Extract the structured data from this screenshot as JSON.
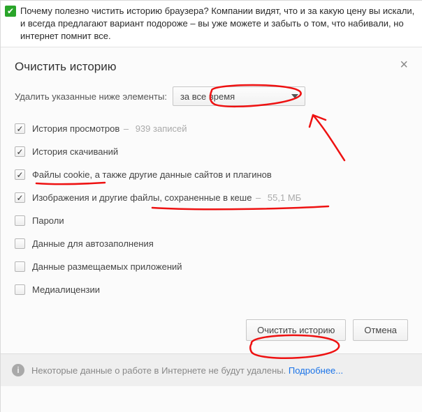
{
  "note": {
    "text": "Почему полезно чистить историю браузера? Компании видят, что и за какую цену вы искали, и всегда предлагают вариант подороже – вы уже можете и забыть о том, что набивали, но интернет помнит все."
  },
  "dialog": {
    "title": "Очистить историю",
    "close": "×",
    "deleteLabel": "Удалить указанные ниже элементы:",
    "combo": {
      "selected": "за все время"
    }
  },
  "options": [
    {
      "label": "История просмотров",
      "hint": "939 записей",
      "checked": true
    },
    {
      "label": "История скачиваний",
      "hint": "",
      "checked": true
    },
    {
      "label": "Файлы cookie, а также другие данные сайтов и плагинов",
      "hint": "",
      "checked": true
    },
    {
      "label": "Изображения и другие файлы, сохраненные в кеше",
      "hint": "55,1 МБ",
      "checked": true
    },
    {
      "label": "Пароли",
      "hint": "",
      "checked": false
    },
    {
      "label": "Данные для автозаполнения",
      "hint": "",
      "checked": false
    },
    {
      "label": "Данные размещаемых приложений",
      "hint": "",
      "checked": false
    },
    {
      "label": "Медиалицензии",
      "hint": "",
      "checked": false
    }
  ],
  "buttons": {
    "clear": "Очистить историю",
    "cancel": "Отмена"
  },
  "footer": {
    "text": "Некоторые данные о работе в Интернете не будут удалены.",
    "link": "Подробнее..."
  }
}
